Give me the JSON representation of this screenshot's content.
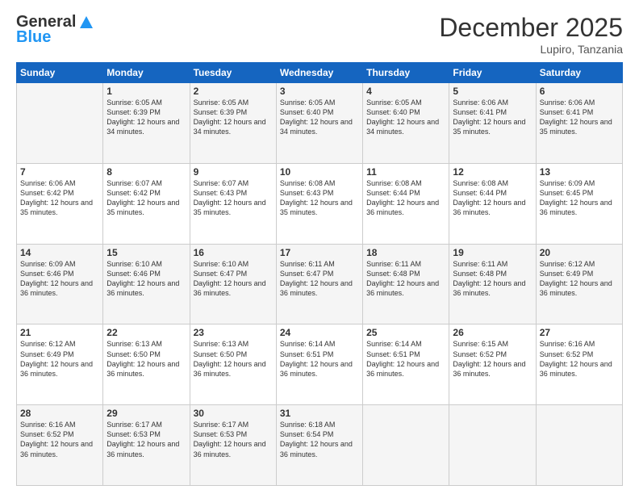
{
  "logo": {
    "general": "General",
    "blue": "Blue"
  },
  "header": {
    "month": "December 2025",
    "location": "Lupiro, Tanzania"
  },
  "weekdays": [
    "Sunday",
    "Monday",
    "Tuesday",
    "Wednesday",
    "Thursday",
    "Friday",
    "Saturday"
  ],
  "weeks": [
    [
      {
        "day": "",
        "sunrise": "",
        "sunset": "",
        "daylight": ""
      },
      {
        "day": "1",
        "sunrise": "Sunrise: 6:05 AM",
        "sunset": "Sunset: 6:39 PM",
        "daylight": "Daylight: 12 hours and 34 minutes."
      },
      {
        "day": "2",
        "sunrise": "Sunrise: 6:05 AM",
        "sunset": "Sunset: 6:39 PM",
        "daylight": "Daylight: 12 hours and 34 minutes."
      },
      {
        "day": "3",
        "sunrise": "Sunrise: 6:05 AM",
        "sunset": "Sunset: 6:40 PM",
        "daylight": "Daylight: 12 hours and 34 minutes."
      },
      {
        "day": "4",
        "sunrise": "Sunrise: 6:05 AM",
        "sunset": "Sunset: 6:40 PM",
        "daylight": "Daylight: 12 hours and 34 minutes."
      },
      {
        "day": "5",
        "sunrise": "Sunrise: 6:06 AM",
        "sunset": "Sunset: 6:41 PM",
        "daylight": "Daylight: 12 hours and 35 minutes."
      },
      {
        "day": "6",
        "sunrise": "Sunrise: 6:06 AM",
        "sunset": "Sunset: 6:41 PM",
        "daylight": "Daylight: 12 hours and 35 minutes."
      }
    ],
    [
      {
        "day": "7",
        "sunrise": "Sunrise: 6:06 AM",
        "sunset": "Sunset: 6:42 PM",
        "daylight": "Daylight: 12 hours and 35 minutes."
      },
      {
        "day": "8",
        "sunrise": "Sunrise: 6:07 AM",
        "sunset": "Sunset: 6:42 PM",
        "daylight": "Daylight: 12 hours and 35 minutes."
      },
      {
        "day": "9",
        "sunrise": "Sunrise: 6:07 AM",
        "sunset": "Sunset: 6:43 PM",
        "daylight": "Daylight: 12 hours and 35 minutes."
      },
      {
        "day": "10",
        "sunrise": "Sunrise: 6:08 AM",
        "sunset": "Sunset: 6:43 PM",
        "daylight": "Daylight: 12 hours and 35 minutes."
      },
      {
        "day": "11",
        "sunrise": "Sunrise: 6:08 AM",
        "sunset": "Sunset: 6:44 PM",
        "daylight": "Daylight: 12 hours and 36 minutes."
      },
      {
        "day": "12",
        "sunrise": "Sunrise: 6:08 AM",
        "sunset": "Sunset: 6:44 PM",
        "daylight": "Daylight: 12 hours and 36 minutes."
      },
      {
        "day": "13",
        "sunrise": "Sunrise: 6:09 AM",
        "sunset": "Sunset: 6:45 PM",
        "daylight": "Daylight: 12 hours and 36 minutes."
      }
    ],
    [
      {
        "day": "14",
        "sunrise": "Sunrise: 6:09 AM",
        "sunset": "Sunset: 6:46 PM",
        "daylight": "Daylight: 12 hours and 36 minutes."
      },
      {
        "day": "15",
        "sunrise": "Sunrise: 6:10 AM",
        "sunset": "Sunset: 6:46 PM",
        "daylight": "Daylight: 12 hours and 36 minutes."
      },
      {
        "day": "16",
        "sunrise": "Sunrise: 6:10 AM",
        "sunset": "Sunset: 6:47 PM",
        "daylight": "Daylight: 12 hours and 36 minutes."
      },
      {
        "day": "17",
        "sunrise": "Sunrise: 6:11 AM",
        "sunset": "Sunset: 6:47 PM",
        "daylight": "Daylight: 12 hours and 36 minutes."
      },
      {
        "day": "18",
        "sunrise": "Sunrise: 6:11 AM",
        "sunset": "Sunset: 6:48 PM",
        "daylight": "Daylight: 12 hours and 36 minutes."
      },
      {
        "day": "19",
        "sunrise": "Sunrise: 6:11 AM",
        "sunset": "Sunset: 6:48 PM",
        "daylight": "Daylight: 12 hours and 36 minutes."
      },
      {
        "day": "20",
        "sunrise": "Sunrise: 6:12 AM",
        "sunset": "Sunset: 6:49 PM",
        "daylight": "Daylight: 12 hours and 36 minutes."
      }
    ],
    [
      {
        "day": "21",
        "sunrise": "Sunrise: 6:12 AM",
        "sunset": "Sunset: 6:49 PM",
        "daylight": "Daylight: 12 hours and 36 minutes."
      },
      {
        "day": "22",
        "sunrise": "Sunrise: 6:13 AM",
        "sunset": "Sunset: 6:50 PM",
        "daylight": "Daylight: 12 hours and 36 minutes."
      },
      {
        "day": "23",
        "sunrise": "Sunrise: 6:13 AM",
        "sunset": "Sunset: 6:50 PM",
        "daylight": "Daylight: 12 hours and 36 minutes."
      },
      {
        "day": "24",
        "sunrise": "Sunrise: 6:14 AM",
        "sunset": "Sunset: 6:51 PM",
        "daylight": "Daylight: 12 hours and 36 minutes."
      },
      {
        "day": "25",
        "sunrise": "Sunrise: 6:14 AM",
        "sunset": "Sunset: 6:51 PM",
        "daylight": "Daylight: 12 hours and 36 minutes."
      },
      {
        "day": "26",
        "sunrise": "Sunrise: 6:15 AM",
        "sunset": "Sunset: 6:52 PM",
        "daylight": "Daylight: 12 hours and 36 minutes."
      },
      {
        "day": "27",
        "sunrise": "Sunrise: 6:16 AM",
        "sunset": "Sunset: 6:52 PM",
        "daylight": "Daylight: 12 hours and 36 minutes."
      }
    ],
    [
      {
        "day": "28",
        "sunrise": "Sunrise: 6:16 AM",
        "sunset": "Sunset: 6:52 PM",
        "daylight": "Daylight: 12 hours and 36 minutes."
      },
      {
        "day": "29",
        "sunrise": "Sunrise: 6:17 AM",
        "sunset": "Sunset: 6:53 PM",
        "daylight": "Daylight: 12 hours and 36 minutes."
      },
      {
        "day": "30",
        "sunrise": "Sunrise: 6:17 AM",
        "sunset": "Sunset: 6:53 PM",
        "daylight": "Daylight: 12 hours and 36 minutes."
      },
      {
        "day": "31",
        "sunrise": "Sunrise: 6:18 AM",
        "sunset": "Sunset: 6:54 PM",
        "daylight": "Daylight: 12 hours and 36 minutes."
      },
      {
        "day": "",
        "sunrise": "",
        "sunset": "",
        "daylight": ""
      },
      {
        "day": "",
        "sunrise": "",
        "sunset": "",
        "daylight": ""
      },
      {
        "day": "",
        "sunrise": "",
        "sunset": "",
        "daylight": ""
      }
    ]
  ]
}
